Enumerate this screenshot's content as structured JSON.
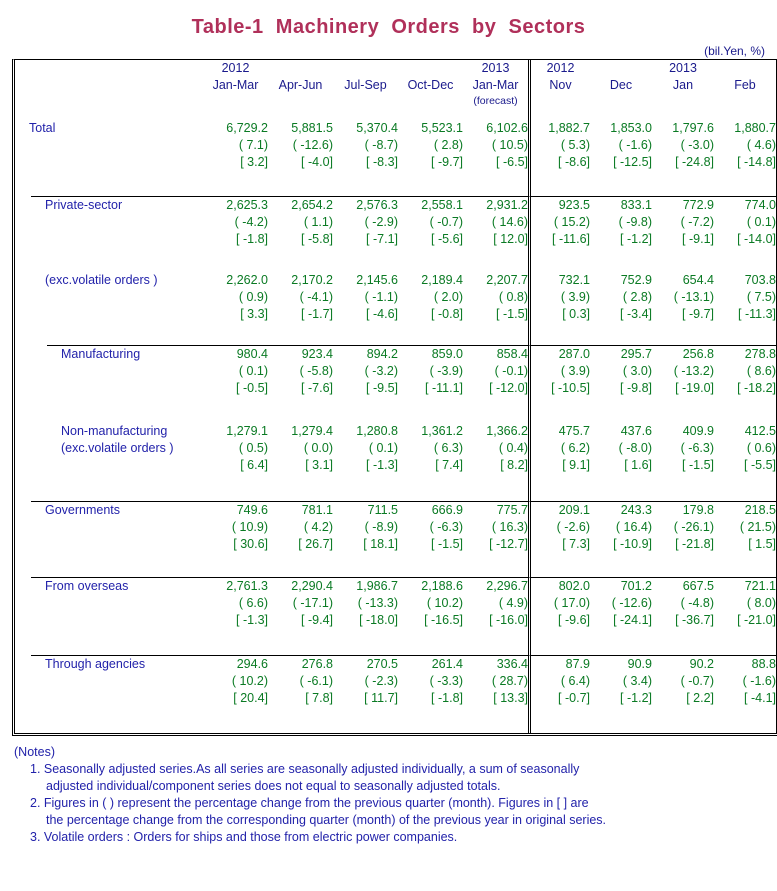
{
  "title": "Table-1  Machinery  Orders  by  Sectors",
  "unit_label": "(bil.Yen, %)",
  "colors": {
    "title": "#b0305a",
    "label_text": "#2222aa",
    "value_text": "#0a7a23",
    "border": "#000000"
  },
  "header": {
    "corner": "",
    "columns": [
      {
        "year": "2012",
        "period": "Jan-Mar",
        "note": ""
      },
      {
        "year": "",
        "period": "Apr-Jun",
        "note": ""
      },
      {
        "year": "",
        "period": "Jul-Sep",
        "note": ""
      },
      {
        "year": "",
        "period": "Oct-Dec",
        "note": ""
      },
      {
        "year": "2013",
        "period": "Jan-Mar",
        "note": "(forecast)"
      },
      {
        "year": "2012",
        "period": "Nov",
        "note": ""
      },
      {
        "year": "",
        "period": "Dec",
        "note": ""
      },
      {
        "year": "2013",
        "period": "Jan",
        "note": ""
      },
      {
        "year": "",
        "period": "Feb",
        "note": ""
      }
    ]
  },
  "rows": [
    {
      "label": "Total",
      "label2": "",
      "level": 0,
      "level_value": [
        "6,729.2",
        "5,881.5",
        "5,370.4",
        "5,523.1",
        "6,102.6",
        "1,882.7",
        "1,853.0",
        "1,797.6",
        "1,880.7"
      ],
      "qoq": [
        "( 7.1)",
        "( -12.6)",
        "( -8.7)",
        "( 2.8)",
        "( 10.5)",
        "( 5.3)",
        "( -1.6)",
        "( -3.0)",
        "( 4.6)"
      ],
      "yoy": [
        "[ 3.2]",
        "[ -4.0]",
        "[ -8.3]",
        "[ -9.7]",
        "[ -6.5]",
        "[ -8.6]",
        "[ -12.5]",
        "[ -24.8]",
        "[ -14.8]"
      ]
    },
    {
      "label": "Private-sector",
      "label2": "",
      "level": 1,
      "level_value": [
        "2,625.3",
        "2,654.2",
        "2,576.3",
        "2,558.1",
        "2,931.2",
        "923.5",
        "833.1",
        "772.9",
        "774.0"
      ],
      "qoq": [
        "( -4.2)",
        "( 1.1)",
        "( -2.9)",
        "( -0.7)",
        "( 14.6)",
        "( 15.2)",
        "( -9.8)",
        "( -7.2)",
        "( 0.1)"
      ],
      "yoy": [
        "[ -1.8]",
        "[ -5.8]",
        "[ -7.1]",
        "[ -5.6]",
        "[ 12.0]",
        "[ -11.6]",
        "[ -1.2]",
        "[ -9.1]",
        "[ -14.0]"
      ]
    },
    {
      "label": "(exc.volatile orders )",
      "label2": "",
      "level": 1,
      "level_value": [
        "2,262.0",
        "2,170.2",
        "2,145.6",
        "2,189.4",
        "2,207.7",
        "732.1",
        "752.9",
        "654.4",
        "703.8"
      ],
      "qoq": [
        "( 0.9)",
        "( -4.1)",
        "( -1.1)",
        "( 2.0)",
        "( 0.8)",
        "( 3.9)",
        "( 2.8)",
        "( -13.1)",
        "( 7.5)"
      ],
      "yoy": [
        "[ 3.3]",
        "[ -1.7]",
        "[ -4.6]",
        "[ -0.8]",
        "[ -1.5]",
        "[ 0.3]",
        "[ -3.4]",
        "[ -9.7]",
        "[ -11.3]"
      ]
    },
    {
      "label": "Manufacturing",
      "label2": "",
      "level": 2,
      "level_value": [
        "980.4",
        "923.4",
        "894.2",
        "859.0",
        "858.4",
        "287.0",
        "295.7",
        "256.8",
        "278.8"
      ],
      "qoq": [
        "( 0.1)",
        "( -5.8)",
        "( -3.2)",
        "( -3.9)",
        "( -0.1)",
        "( 3.9)",
        "( 3.0)",
        "( -13.2)",
        "( 8.6)"
      ],
      "yoy": [
        "[ -0.5]",
        "[ -7.6]",
        "[ -9.5]",
        "[ -11.1]",
        "[ -12.0]",
        "[ -10.5]",
        "[ -9.8]",
        "[ -19.0]",
        "[ -18.2]"
      ]
    },
    {
      "label": "Non-manufacturing",
      "label2": "(exc.volatile orders )",
      "level": 2,
      "level_value": [
        "1,279.1",
        "1,279.4",
        "1,280.8",
        "1,361.2",
        "1,366.2",
        "475.7",
        "437.6",
        "409.9",
        "412.5"
      ],
      "qoq": [
        "( 0.5)",
        "( 0.0)",
        "( 0.1)",
        "( 6.3)",
        "( 0.4)",
        "( 6.2)",
        "( -8.0)",
        "( -6.3)",
        "( 0.6)"
      ],
      "yoy": [
        "[ 6.4]",
        "[ 3.1]",
        "[ -1.3]",
        "[ 7.4]",
        "[ 8.2]",
        "[ 9.1]",
        "[ 1.6]",
        "[ -1.5]",
        "[ -5.5]"
      ]
    },
    {
      "label": "Governments",
      "label2": "",
      "level": 1,
      "level_value": [
        "749.6",
        "781.1",
        "711.5",
        "666.9",
        "775.7",
        "209.1",
        "243.3",
        "179.8",
        "218.5"
      ],
      "qoq": [
        "( 10.9)",
        "( 4.2)",
        "( -8.9)",
        "( -6.3)",
        "( 16.3)",
        "( -2.6)",
        "( 16.4)",
        "( -26.1)",
        "( 21.5)"
      ],
      "yoy": [
        "[ 30.6]",
        "[ 26.7]",
        "[ 18.1]",
        "[ -1.5]",
        "[ -12.7]",
        "[ 7.3]",
        "[ -10.9]",
        "[ -21.8]",
        "[ 1.5]"
      ]
    },
    {
      "label": "From overseas",
      "label2": "",
      "level": 1,
      "level_value": [
        "2,761.3",
        "2,290.4",
        "1,986.7",
        "2,188.6",
        "2,296.7",
        "802.0",
        "701.2",
        "667.5",
        "721.1"
      ],
      "qoq": [
        "( 6.6)",
        "( -17.1)",
        "( -13.3)",
        "( 10.2)",
        "( 4.9)",
        "( 17.0)",
        "( -12.6)",
        "( -4.8)",
        "( 8.0)"
      ],
      "yoy": [
        "[ -1.3]",
        "[ -9.4]",
        "[ -18.0]",
        "[ -16.5]",
        "[ -16.0]",
        "[ -9.6]",
        "[ -24.1]",
        "[ -36.7]",
        "[ -21.0]"
      ]
    },
    {
      "label": "Through agencies",
      "label2": "",
      "level": 1,
      "level_value": [
        "294.6",
        "276.8",
        "270.5",
        "261.4",
        "336.4",
        "87.9",
        "90.9",
        "90.2",
        "88.8"
      ],
      "qoq": [
        "( 10.2)",
        "( -6.1)",
        "( -2.3)",
        "( -3.3)",
        "( 28.7)",
        "( 6.4)",
        "( 3.4)",
        "( -0.7)",
        "( -1.6)"
      ],
      "yoy": [
        "[ 20.4]",
        "[ 7.8]",
        "[ 11.7]",
        "[ -1.8]",
        "[ 13.3]",
        "[ -0.7]",
        "[ -1.2]",
        "[ 2.2]",
        "[ -4.1]"
      ]
    }
  ],
  "notes": {
    "heading": "(Notes)",
    "items": [
      {
        "line1": "1. Seasonally adjusted series.As all series are seasonally adjusted individually, a sum of seasonally",
        "line2": "adjusted individual/component series does not equal to seasonally adjusted totals."
      },
      {
        "line1": "2. Figures in ( ) represent the percentage change from the previous quarter (month). Figures in [ ] are",
        "line2": "the percentage change from the corresponding quarter (month) of the previous year in original series."
      },
      {
        "line1": "3. Volatile orders : Orders for ships and those from electric power companies.",
        "line2": ""
      }
    ]
  }
}
